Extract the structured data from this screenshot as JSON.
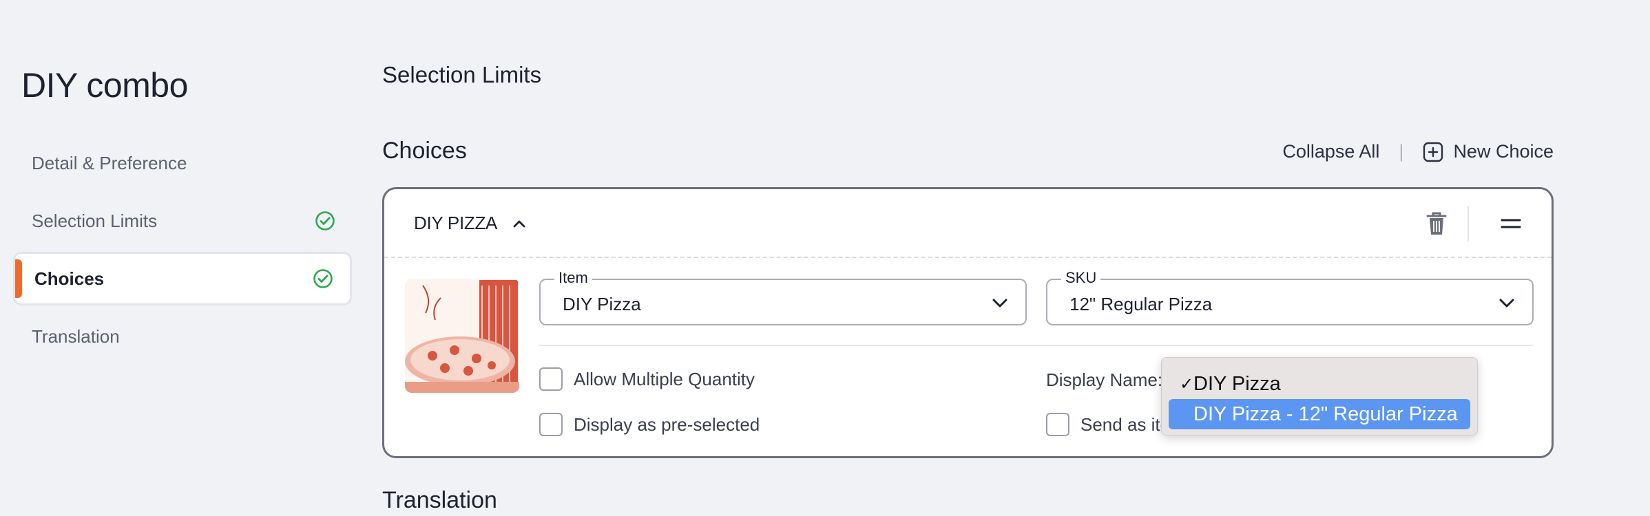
{
  "page": {
    "title": "DIY combo"
  },
  "nav": {
    "items": [
      {
        "label": "Detail & Preference",
        "checked": false,
        "active": false
      },
      {
        "label": "Selection Limits",
        "checked": true,
        "active": false
      },
      {
        "label": "Choices",
        "checked": true,
        "active": true
      },
      {
        "label": "Translation",
        "checked": false,
        "active": false
      }
    ]
  },
  "sections": {
    "selection_limits": "Selection Limits",
    "choices": "Choices",
    "translation": "Translation"
  },
  "actions": {
    "collapse_all": "Collapse All",
    "separator": "|",
    "new_choice": "New Choice"
  },
  "choice": {
    "title": "DIY PIZZA",
    "item_field": {
      "label": "Item",
      "value": "DIY Pizza"
    },
    "sku_field": {
      "label": "SKU",
      "value": "12\" Regular Pizza"
    },
    "allow_multiple": "Allow Multiple Quantity",
    "preselected": "Display as pre-selected",
    "display_name_label": "Display Name:",
    "send_as_item": "Send as ite"
  },
  "display_name_dropdown": {
    "options": [
      {
        "label": "DIY Pizza",
        "selected": true
      },
      {
        "label": "DIY Pizza - 12\" Regular Pizza",
        "selected": false,
        "highlighted": true
      }
    ],
    "checkmark": "✓"
  },
  "colors": {
    "accent": "#ef6a2c",
    "check_green": "#2fa84f",
    "highlight": "#5b96f2"
  }
}
